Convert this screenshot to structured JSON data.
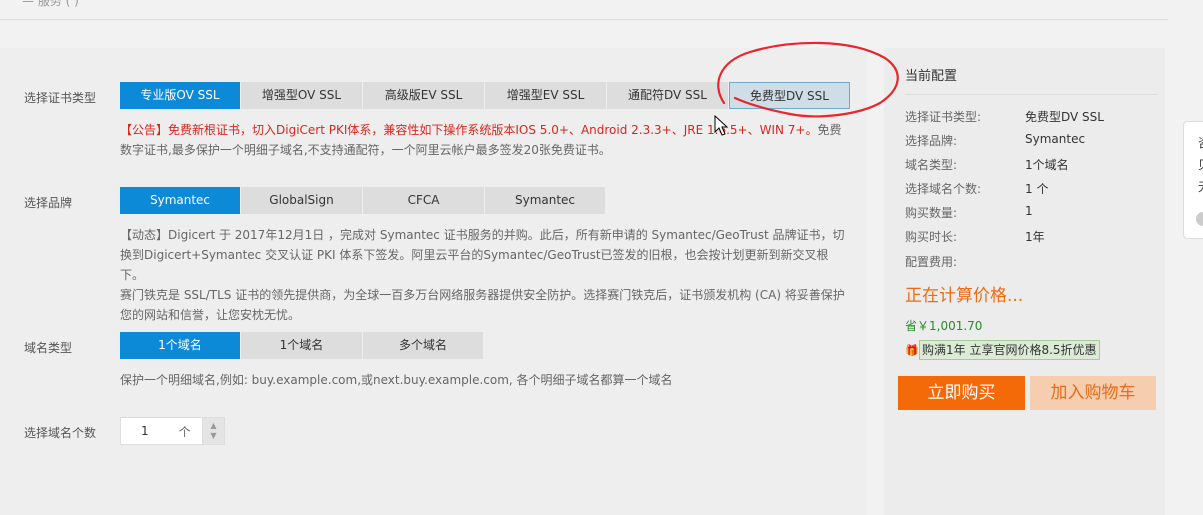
{
  "header": {
    "fragment": "— 服务 (  )"
  },
  "cert_type": {
    "label": "选择证书类型",
    "options": [
      "专业版OV SSL",
      "增强型OV SSL",
      "高级版EV SSL",
      "增强型EV SSL",
      "通配符DV SSL",
      "免费型DV SSL"
    ],
    "selected": "专业版OV SSL",
    "highlighted": "免费型DV SSL",
    "notice_red": "【公告】免费新根证书，切入DigiCert PKI体系，兼容性如下操作系统版本IOS 5.0+、Android 2.3.3+、JRE 1.6.5+、WIN 7+。",
    "notice_gray": "免费数字证书,最多保护一个明细子域名,不支持通配符，一个阿里云帐户最多签发20张免费证书。"
  },
  "brand": {
    "label": "选择品牌",
    "options": [
      "Symantec",
      "GlobalSign",
      "CFCA",
      "Symantec"
    ],
    "selected": "Symantec",
    "desc_line1": "【动态】Digicert 于 2017年12月1日 ，完成对 Symantec 证书服务的并购。此后，所有新申请的 Symantec/GeoTrust 品牌证书，切换到Digicert+Symantec 交叉认证 PKI 体系下签发。阿里云平台的Symantec/GeoTrust已签发的旧根，也会按计划更新到新交叉根下。",
    "desc_line2": "赛门铁克是 SSL/TLS 证书的领先提供商，为全球一百多万台网络服务器提供安全防护。选择赛门铁克后，证书颁发机构 (CA) 将妥善保护您的网站和信誉，让您安枕无忧。"
  },
  "domain_type": {
    "label": "域名类型",
    "options": [
      "1个域名",
      "1个域名",
      "多个域名"
    ],
    "selected": "1个域名",
    "desc": "保护一个明细域名,例如: buy.example.com,或next.buy.example.com, 各个明细子域名都算一个域名"
  },
  "domain_count": {
    "label": "选择域名个数",
    "value": "1",
    "unit": "个"
  },
  "summary": {
    "title": "当前配置",
    "rows": [
      {
        "k": "选择证书类型:",
        "v": "免费型DV SSL"
      },
      {
        "k": "选择品牌:",
        "v": "Symantec"
      },
      {
        "k": "域名类型:",
        "v": "1个域名"
      },
      {
        "k": "选择域名个数:",
        "v": "1 个"
      },
      {
        "k": "购买数量:",
        "v": "1"
      },
      {
        "k": "购买时长:",
        "v": "1年"
      },
      {
        "k": "配置费用:",
        "v": ""
      }
    ],
    "price_status": "正在计算价格...",
    "save_text": "省￥1,001.70",
    "promo_text": "购满1年 立享官网价格8.5折优惠",
    "buy_label": "立即购买",
    "cart_label": "加入购物车"
  },
  "float_panel": {
    "lines": [
      "咨",
      "贝",
      "无"
    ]
  },
  "colors": {
    "accent": "#0c8ad8",
    "buy": "#f46a08",
    "price": "#f06a11",
    "notice": "#d9261c",
    "annotation": "#e8262b"
  },
  "icons": {
    "stepper": "up-down-arrows-icon",
    "promo": "gift-icon",
    "cursor": "mouse-pointer-icon"
  }
}
